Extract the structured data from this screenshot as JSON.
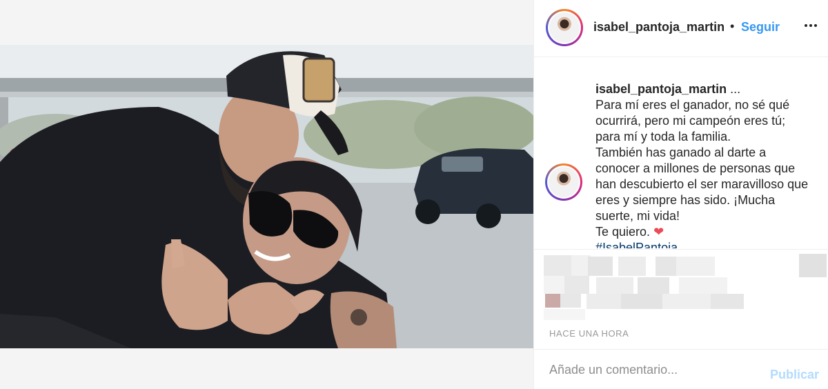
{
  "post": {
    "username": "isabel_pantoja_martin",
    "separator": "•",
    "follow_label": "Seguir",
    "more_icon": "more-horizontal-icon",
    "caption": {
      "username": "isabel_pantoja_martin",
      "ellipsis": "...",
      "lines": [
        "Para mí eres el ganador, no sé qué",
        "ocurrirá, pero mi campeón eres tú;",
        "para mí y toda la familia.",
        "También has ganado al darte a",
        "conocer a millones de personas que",
        "han descubierto el ser maravilloso que",
        "eres y siempre has sido. ¡Mucha",
        "suerte, mi vida!",
        "Te quiero."
      ],
      "heart": "❤",
      "tag_partial": "#IsabelPantoja"
    },
    "timestamp": "HACE UNA HORA",
    "comment_placeholder": "Añade un comentario...",
    "publish_label": "Publicar"
  },
  "colors": {
    "link_blue": "#3897f0",
    "publish_disabled": "#b3dbff",
    "heart_red": "#ed4956",
    "muted_gray": "#999999"
  }
}
